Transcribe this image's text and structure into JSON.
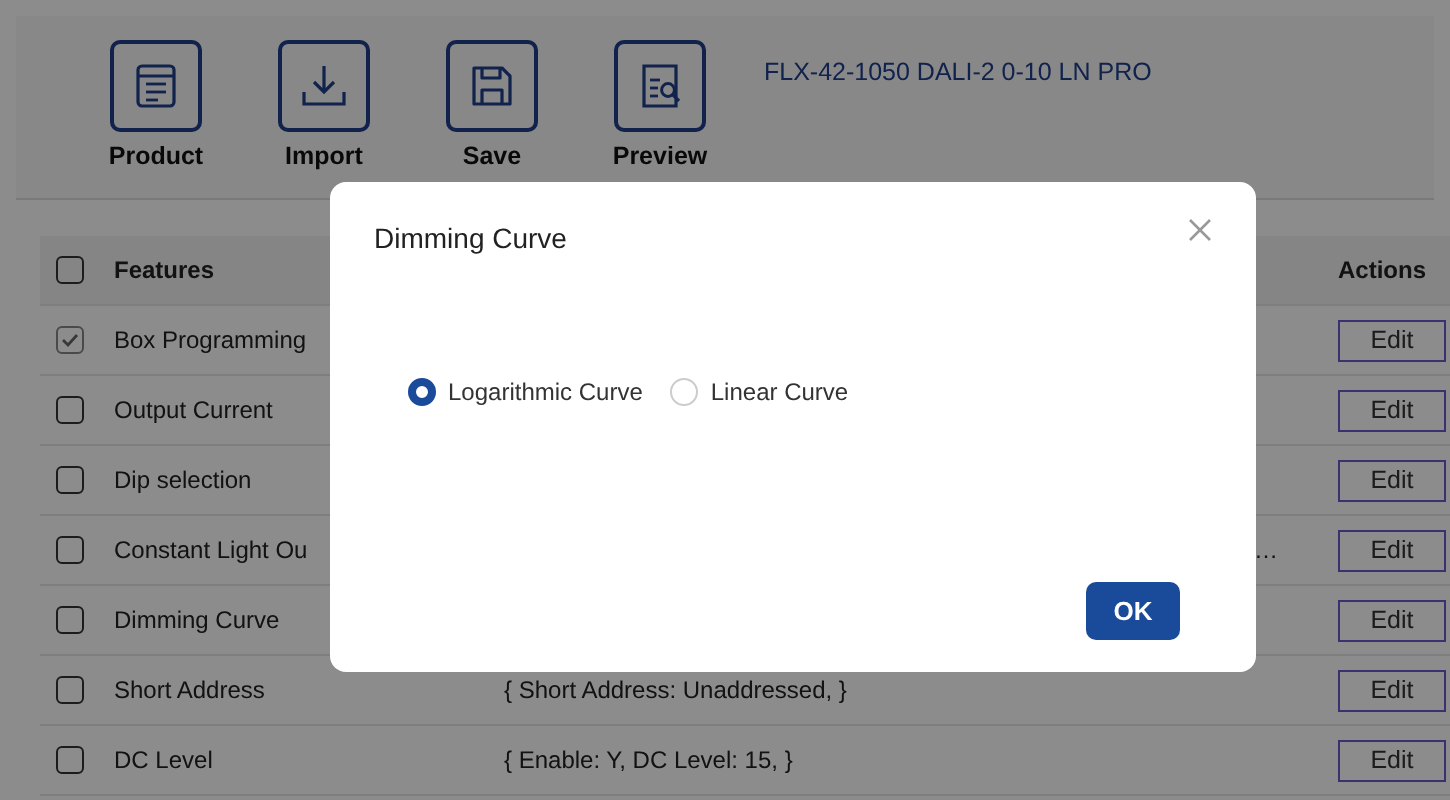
{
  "toolbar": {
    "buttons": [
      {
        "kind": "product",
        "label": "Product"
      },
      {
        "kind": "import",
        "label": "Import"
      },
      {
        "kind": "save",
        "label": "Save"
      },
      {
        "kind": "preview",
        "label": "Preview"
      }
    ],
    "product_name": "FLX-42-1050 DALI-2 0-10 LN PRO"
  },
  "table": {
    "columns": [
      {
        "label": "Features",
        "kind": "feature"
      },
      {
        "label": "Actions",
        "kind": "actions"
      }
    ],
    "header_checked": false,
    "rows": [
      {
        "checked": true,
        "feature": "Box Programming",
        "action": "Edit"
      },
      {
        "checked": false,
        "feature": "Output Current",
        "action": "Edit"
      },
      {
        "checked": false,
        "feature": "Dip selection",
        "action": "Edit"
      },
      {
        "checked": false,
        "feature": "Constant Light Ou",
        "value": "…",
        "value_cut": true,
        "action": "Edit"
      },
      {
        "checked": false,
        "feature": "Dimming Curve",
        "action": "Edit"
      },
      {
        "checked": false,
        "feature": "Short Address",
        "value": "{ Short Address: Unaddressed, }",
        "value_cut": false,
        "action": "Edit"
      },
      {
        "checked": false,
        "feature": "DC Level",
        "value": "{ Enable: Y, DC Level: 15, }",
        "value_cut": false,
        "action": "Edit"
      }
    ]
  },
  "dialog": {
    "title": "Dimming Curve",
    "options": [
      {
        "label": "Logarithmic Curve",
        "selected": true
      },
      {
        "label": "Linear Curve",
        "selected": false
      }
    ],
    "ok": "OK"
  }
}
